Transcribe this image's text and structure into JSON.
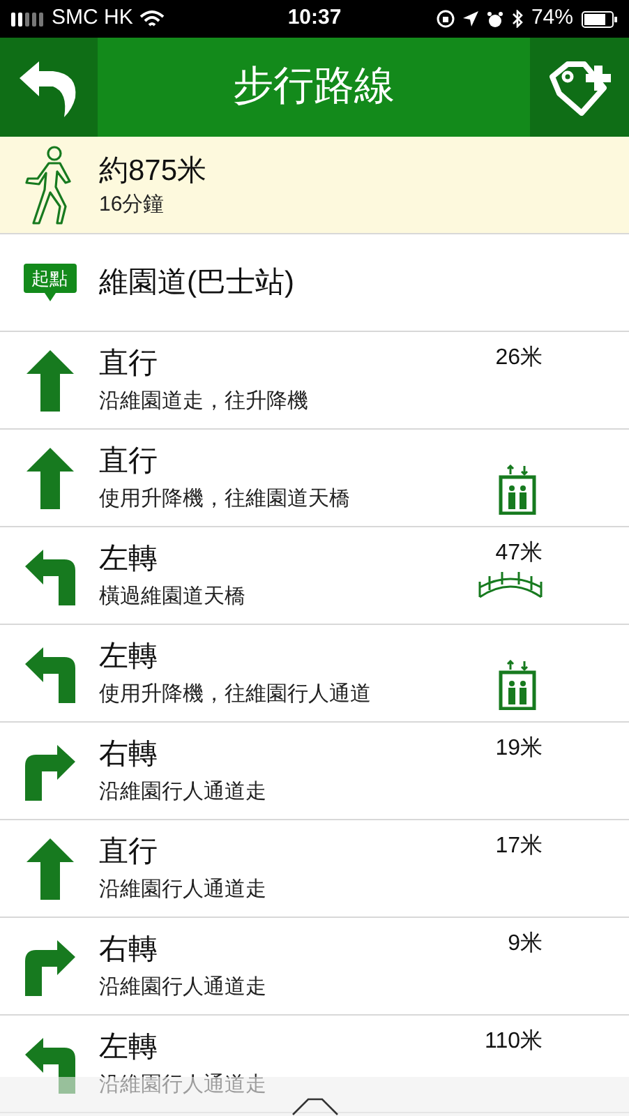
{
  "status_bar": {
    "carrier": "SMC HK",
    "time": "10:37",
    "battery": "74%"
  },
  "header": {
    "title": "步行路線"
  },
  "summary": {
    "distance": "約875米",
    "duration": "16分鐘"
  },
  "start": {
    "badge": "起點",
    "name": "維園道(巴士站)"
  },
  "steps": [
    {
      "kind": "straight",
      "action": "直行",
      "detail": "沿維園道走，往升降機",
      "distance": "26米"
    },
    {
      "kind": "straight",
      "action": "直行",
      "detail": "使用升降機，往維園道天橋",
      "facility": {
        "kind": "elevator"
      }
    },
    {
      "kind": "left",
      "action": "左轉",
      "detail": "橫過維園道天橋",
      "distance": "47米",
      "facility": {
        "kind": "bridge"
      }
    },
    {
      "kind": "left",
      "action": "左轉",
      "detail": "使用升降機，往維園行人通道",
      "facility": {
        "kind": "elevator"
      }
    },
    {
      "kind": "right",
      "action": "右轉",
      "detail": "沿維園行人通道走",
      "distance": "19米"
    },
    {
      "kind": "straight",
      "action": "直行",
      "detail": "沿維園行人通道走",
      "distance": "17米"
    },
    {
      "kind": "right",
      "action": "右轉",
      "detail": "沿維園行人通道走",
      "distance": "9米"
    },
    {
      "kind": "left",
      "action": "左轉",
      "detail": "沿維園行人通道走",
      "distance": "110米"
    }
  ]
}
